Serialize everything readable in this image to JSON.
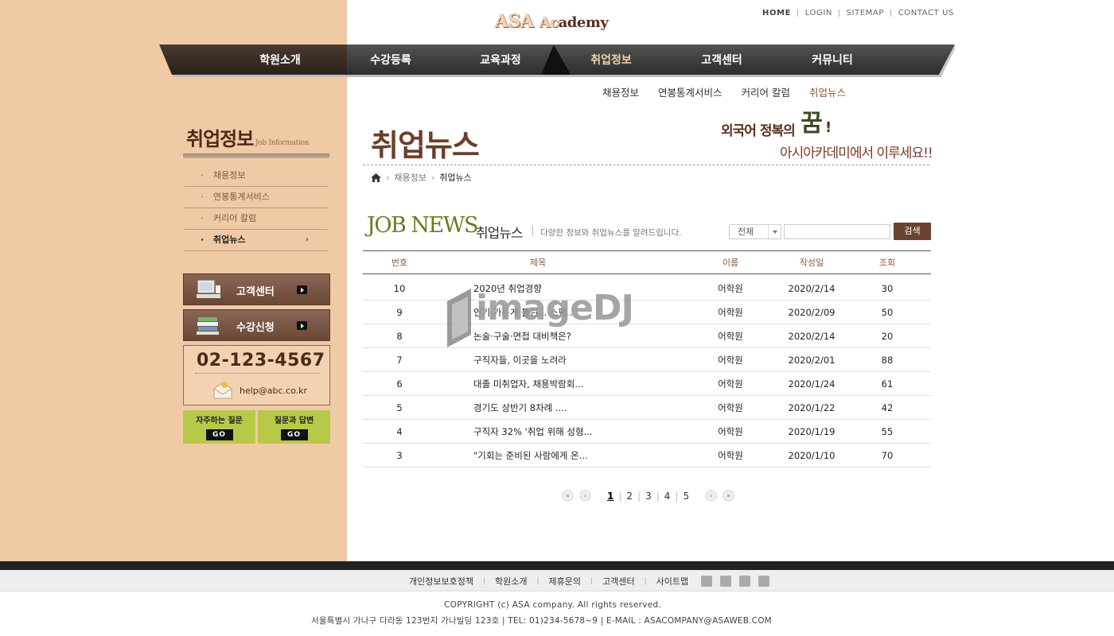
{
  "logo": {
    "a1": "ASA ",
    "a2": "Ac",
    "rest": "ademy"
  },
  "top_links": {
    "home": "HOME",
    "login": "LOGIN",
    "sitemap": "SITEMAP",
    "contact": "CONTACT US"
  },
  "nav": {
    "items": [
      "학원소개",
      "수강등록",
      "교육과정",
      "취업정보",
      "고객센터",
      "커뮤니티"
    ],
    "active": "취업정보"
  },
  "subnav": {
    "items": [
      "채용정보",
      "연봉통계서비스",
      "커리어 칼럼",
      "취업뉴스"
    ],
    "active": "취업뉴스"
  },
  "sidebar": {
    "title": "취업정보",
    "subtitle": "Job Information",
    "menu": [
      "채용정보",
      "연봉통계서비스",
      "커리어 칼럼",
      "취업뉴스"
    ],
    "active_arrow": "›",
    "btn_customer": "고객센터",
    "btn_register": "수강신청",
    "phone": "02-123-4567",
    "email": "help@abc.co.kr",
    "faq1": "자주하는 질문",
    "faq2": "질문과 답변",
    "go": "GO"
  },
  "content": {
    "page_title": "취업뉴스",
    "slogan1": "외국어 정복의",
    "slogan_big": "꿈",
    "slogan_ex": "!",
    "slogan2": "아시아카데미에서 이루세요!!",
    "breadcrumb": [
      "채용정보",
      "취업뉴스"
    ],
    "section_en": "JOB NEWS",
    "section_kr": "취업뉴스",
    "section_desc": "다양한 정보와 취업뉴스를 알려드립니다.",
    "filter_value": "전체",
    "search_label": "검색",
    "search_value": ""
  },
  "table": {
    "headers": {
      "num": "번호",
      "title": "제목",
      "name": "이름",
      "date": "작성일",
      "views": "조회"
    },
    "rows": [
      {
        "num": "10",
        "title": "2020년 취업경향",
        "name": "어학원",
        "date": "2020/2/14",
        "views": "30"
      },
      {
        "num": "9",
        "title": "인기 가는게 틀린... 스펙...",
        "name": "어학원",
        "date": "2020/2/09",
        "views": "50"
      },
      {
        "num": "8",
        "title": "논술·구술·면접 대비책은?",
        "name": "어학원",
        "date": "2020/2/14",
        "views": "20"
      },
      {
        "num": "7",
        "title": "구직자들, 이곳을 노려라",
        "name": "어학원",
        "date": "2020/2/01",
        "views": "88"
      },
      {
        "num": "6",
        "title": "대졸 미취업자, 채용박람회...",
        "name": "어학원",
        "date": "2020/1/24",
        "views": "61"
      },
      {
        "num": "5",
        "title": "경기도 상반기 8차례 ....",
        "name": "어학원",
        "date": "2020/1/22",
        "views": "42"
      },
      {
        "num": "4",
        "title": "구직자 32% '취업 위해 성형...",
        "name": "어학원",
        "date": "2020/1/19",
        "views": "55"
      },
      {
        "num": "3",
        "title": "\"기회는 준비된 사람에게 온...",
        "name": "어학원",
        "date": "2020/1/10",
        "views": "70"
      }
    ]
  },
  "pager": {
    "first": "«",
    "prev": "‹",
    "pages": [
      "1",
      "2",
      "3",
      "4",
      "5"
    ],
    "current": "1",
    "next": "›",
    "last": "»"
  },
  "watermark": "imageDJ",
  "footer": {
    "links": [
      "개인정보보호정책",
      "학원소개",
      "제휴문의",
      "고객센터",
      "사이트맵"
    ],
    "copyright": "COPYRIGHT (c) ASA company. All rights reserved.",
    "address": "서울특별시 가나구 다라동 123번지 가나빌딩 123호  |  TEL: 01)234-5678~9  |  E-MAIL : ASACOMPANY@ASAWEB.COM"
  },
  "colors": {
    "left_bg": "#f0caa4",
    "brown": "#6b4332",
    "nav_dark": "#3a2e28",
    "olive": "#6b7a1e",
    "faq_green": "#b8c94a"
  }
}
